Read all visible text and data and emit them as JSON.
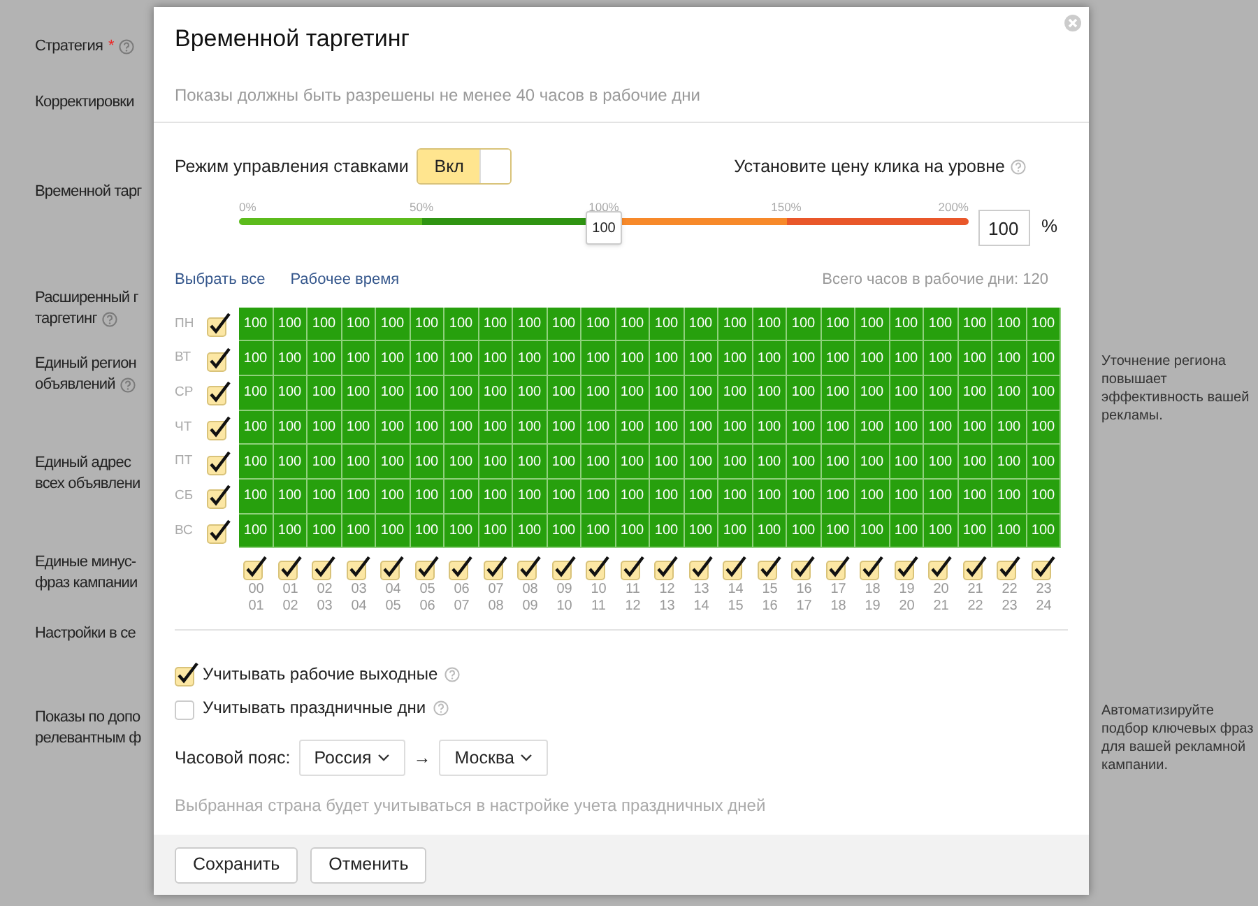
{
  "background_form": {
    "labels": [
      {
        "lines": [
          "Стратегия"
        ],
        "required_mark": "*",
        "help": true
      },
      {
        "lines": [
          "Корректировки"
        ]
      },
      {
        "lines": [
          "Временной тарг"
        ]
      },
      {
        "lines": [
          "Расширенный г",
          "таргетинг"
        ],
        "help": true
      },
      {
        "lines": [
          "Единый регион",
          "объявлений"
        ],
        "help": true
      },
      {
        "lines": [
          "Единый адрес",
          "всех объявлени"
        ]
      },
      {
        "lines": [
          "Единые минус-",
          "фраз кампании"
        ]
      },
      {
        "lines": [
          "Настройки в се"
        ]
      },
      {
        "lines": [
          "Показы по допо",
          "релевантным ф"
        ]
      }
    ],
    "hints": [
      "Уточнение региона повышает эффективность вашей рекламы.",
      "Автоматизируйте подбор ключевых фраз для вашей рекламной кампании."
    ]
  },
  "dialog": {
    "title": "Временной таргетинг",
    "subtitle": "Показы должны быть разрешены не менее 40 часов в рабочие дни",
    "bid_mode": {
      "label": "Режим управления ставками",
      "toggle": {
        "label": "Вкл",
        "on": true
      }
    },
    "click_price_label": "Установите цену клика на уровне",
    "slider": {
      "ticks": [
        "0%",
        "50%",
        "100%",
        "150%",
        "200%"
      ],
      "level": 0.5,
      "thumb": "100",
      "value": "100",
      "unit": "%"
    },
    "links": [
      "Выбрать все",
      "Рабочее время"
    ],
    "total_hours": "Всего часов в рабочие дни: 120",
    "days": [
      {
        "day": "ПН",
        "checked": true,
        "cells": [
          "100",
          "100",
          "100",
          "100",
          "100",
          "100",
          "100",
          "100",
          "100",
          "100",
          "100",
          "100",
          "100",
          "100",
          "100",
          "100",
          "100",
          "100",
          "100",
          "100",
          "100",
          "100",
          "100",
          "100"
        ]
      },
      {
        "day": "ВТ",
        "checked": true,
        "cells": [
          "100",
          "100",
          "100",
          "100",
          "100",
          "100",
          "100",
          "100",
          "100",
          "100",
          "100",
          "100",
          "100",
          "100",
          "100",
          "100",
          "100",
          "100",
          "100",
          "100",
          "100",
          "100",
          "100",
          "100"
        ]
      },
      {
        "day": "СР",
        "checked": true,
        "cells": [
          "100",
          "100",
          "100",
          "100",
          "100",
          "100",
          "100",
          "100",
          "100",
          "100",
          "100",
          "100",
          "100",
          "100",
          "100",
          "100",
          "100",
          "100",
          "100",
          "100",
          "100",
          "100",
          "100",
          "100"
        ]
      },
      {
        "day": "ЧТ",
        "checked": true,
        "cells": [
          "100",
          "100",
          "100",
          "100",
          "100",
          "100",
          "100",
          "100",
          "100",
          "100",
          "100",
          "100",
          "100",
          "100",
          "100",
          "100",
          "100",
          "100",
          "100",
          "100",
          "100",
          "100",
          "100",
          "100"
        ]
      },
      {
        "day": "ПТ",
        "checked": true,
        "cells": [
          "100",
          "100",
          "100",
          "100",
          "100",
          "100",
          "100",
          "100",
          "100",
          "100",
          "100",
          "100",
          "100",
          "100",
          "100",
          "100",
          "100",
          "100",
          "100",
          "100",
          "100",
          "100",
          "100",
          "100"
        ]
      },
      {
        "day": "СБ",
        "checked": true,
        "cells": [
          "100",
          "100",
          "100",
          "100",
          "100",
          "100",
          "100",
          "100",
          "100",
          "100",
          "100",
          "100",
          "100",
          "100",
          "100",
          "100",
          "100",
          "100",
          "100",
          "100",
          "100",
          "100",
          "100",
          "100"
        ]
      },
      {
        "day": "ВС",
        "checked": true,
        "cells": [
          "100",
          "100",
          "100",
          "100",
          "100",
          "100",
          "100",
          "100",
          "100",
          "100",
          "100",
          "100",
          "100",
          "100",
          "100",
          "100",
          "100",
          "100",
          "100",
          "100",
          "100",
          "100",
          "100",
          "100"
        ]
      }
    ],
    "hours": [
      {
        "from": "00",
        "to": "01",
        "checked": true
      },
      {
        "from": "01",
        "to": "02",
        "checked": true
      },
      {
        "from": "02",
        "to": "03",
        "checked": true
      },
      {
        "from": "03",
        "to": "04",
        "checked": true
      },
      {
        "from": "04",
        "to": "05",
        "checked": true
      },
      {
        "from": "05",
        "to": "06",
        "checked": true
      },
      {
        "from": "06",
        "to": "07",
        "checked": true
      },
      {
        "from": "07",
        "to": "08",
        "checked": true
      },
      {
        "from": "08",
        "to": "09",
        "checked": true
      },
      {
        "from": "09",
        "to": "10",
        "checked": true
      },
      {
        "from": "10",
        "to": "11",
        "checked": true
      },
      {
        "from": "11",
        "to": "12",
        "checked": true
      },
      {
        "from": "12",
        "to": "13",
        "checked": true
      },
      {
        "from": "13",
        "to": "14",
        "checked": true
      },
      {
        "from": "14",
        "to": "15",
        "checked": true
      },
      {
        "from": "15",
        "to": "16",
        "checked": true
      },
      {
        "from": "16",
        "to": "17",
        "checked": true
      },
      {
        "from": "17",
        "to": "18",
        "checked": true
      },
      {
        "from": "18",
        "to": "19",
        "checked": true
      },
      {
        "from": "19",
        "to": "20",
        "checked": true
      },
      {
        "from": "20",
        "to": "21",
        "checked": true
      },
      {
        "from": "21",
        "to": "22",
        "checked": true
      },
      {
        "from": "22",
        "to": "23",
        "checked": true
      },
      {
        "from": "23",
        "to": "24",
        "checked": true
      }
    ],
    "options": [
      {
        "label": "Учитывать рабочие выходные",
        "checked": true
      },
      {
        "label": "Учитывать праздничные дни",
        "checked": false
      }
    ],
    "timezone": {
      "label": "Часовой пояс:",
      "country": "Россия",
      "arrow": "→",
      "city": "Москва"
    },
    "note": "Выбранная страна будет учитываться в настройке учета праздничных дней",
    "buttons": [
      "Сохранить",
      "Отменить"
    ]
  }
}
